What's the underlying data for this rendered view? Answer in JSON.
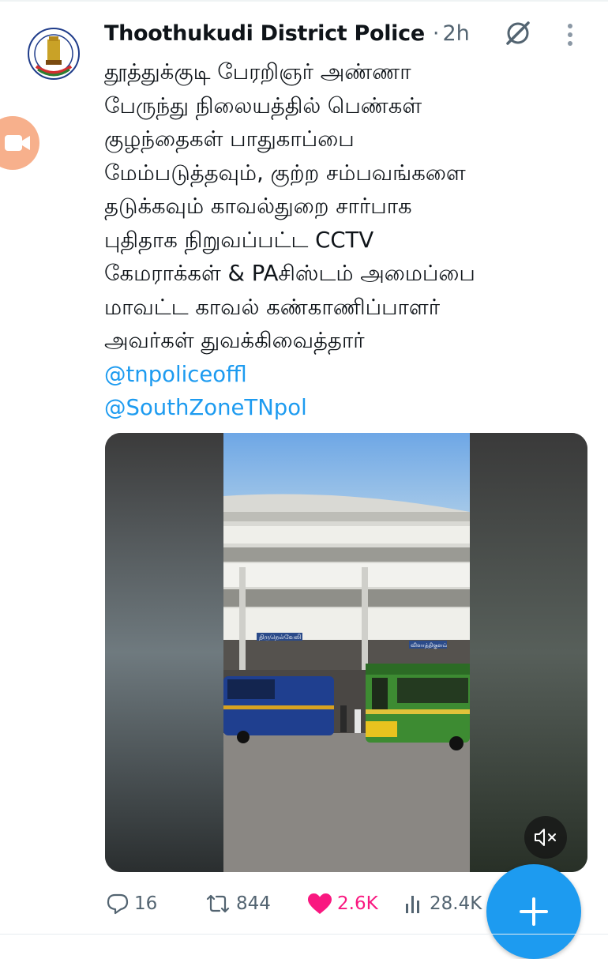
{
  "tweet": {
    "author_name": "Thoothukudi District Police",
    "separator": "·",
    "time_ago": "2h",
    "avatar_icon": "tamilnadu-police-emblem",
    "body_lines": [
      "தூத்துக்குடி பேரறிஞர் அண்ணா",
      "பேருந்து நிலையத்தில் பெண்கள்",
      "குழந்தைகள் பாதுகாப்பை",
      "மேம்படுத்தவும், குற்ற சம்பவங்களை",
      "தடுக்கவும் காவல்துறை சார்பாக",
      "புதிதாக நிறுவப்பட்ட CCTV",
      "கேமராக்கள் & PAசிஸ்டம் அமைப்பை",
      "மாவட்ட காவல் கண்காணிப்பாளர்",
      "அவர்கள் துவக்கிவைத்தார்"
    ],
    "mentions": [
      "@tnpoliceoffl",
      "@SouthZoneTNpol"
    ],
    "media": {
      "type": "video",
      "muted": true,
      "building_signs": [
        "திருநெல்வேலி",
        "விளாத்திகுளம்"
      ]
    },
    "actions": {
      "replies": "16",
      "retweets": "844",
      "likes": "2.6K",
      "views": "28.4K"
    }
  },
  "colors": {
    "accent": "#1d9bf0",
    "like": "#f91880",
    "secondary_text": "#536471",
    "video_fab": "#f7b08c"
  },
  "icons": [
    "grok-icon",
    "more-vertical-icon",
    "video-camera-icon",
    "mute-icon",
    "reply-icon",
    "retweet-icon",
    "heart-filled-icon",
    "views-icon",
    "plus-icon"
  ]
}
